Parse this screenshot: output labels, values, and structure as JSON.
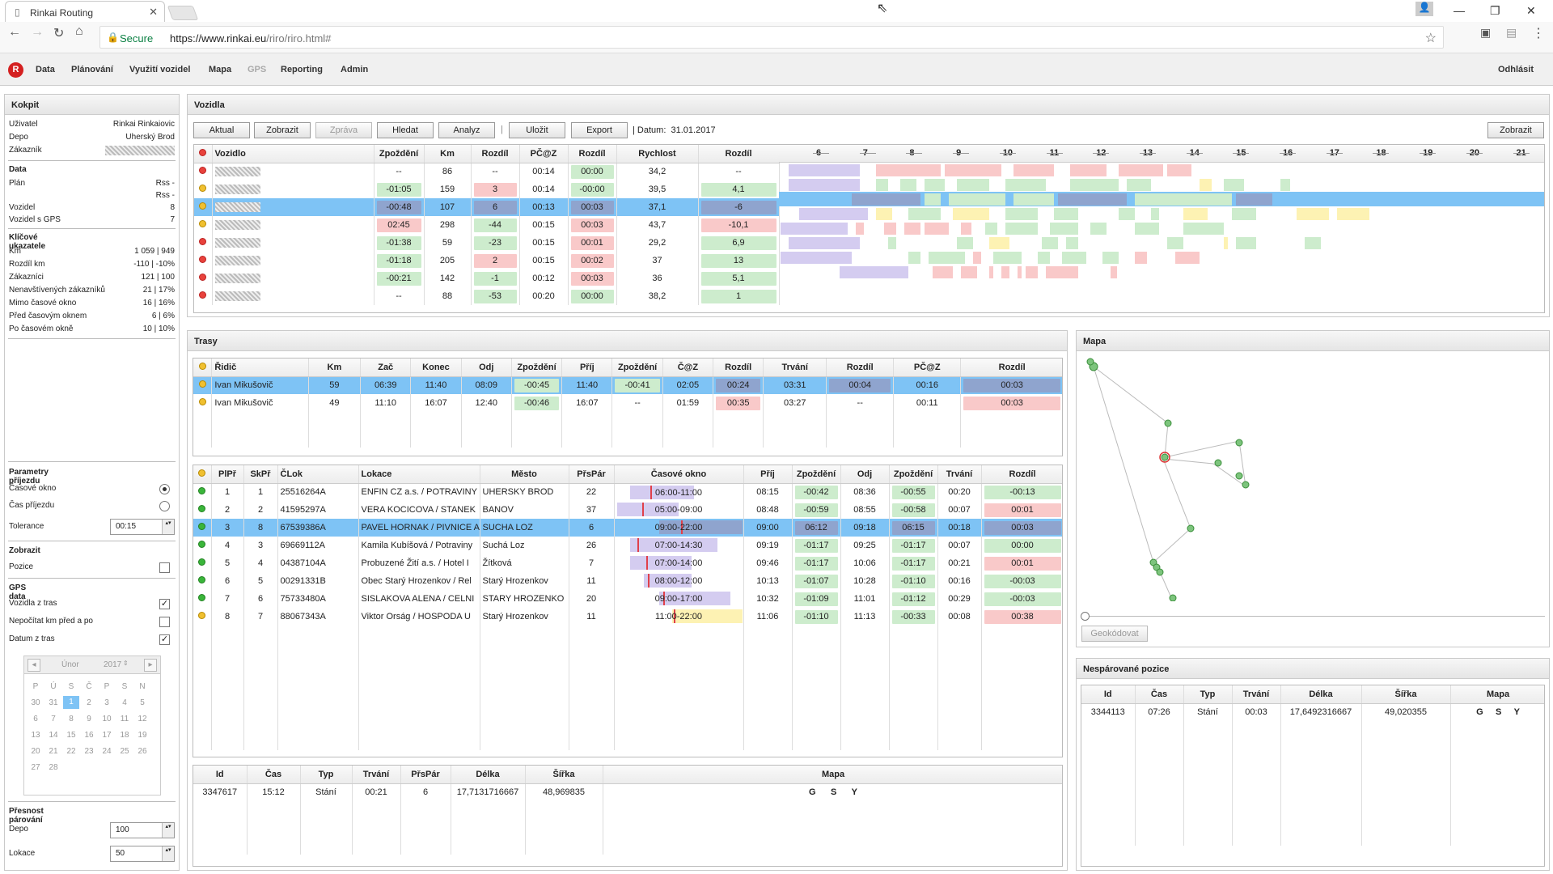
{
  "browser": {
    "tab_title": "Rinkai Routing",
    "secure_label": "Secure",
    "url_base": "https://www.rinkai.eu",
    "url_path": "/riro/riro.html#"
  },
  "menu": {
    "items": [
      "Data",
      "Plánování",
      "Využití vozidel",
      "Mapa",
      "GPS",
      "Reporting",
      "Admin"
    ],
    "logout": "Odhlásit"
  },
  "kokpit": {
    "title": "Kokpit",
    "user_rows": [
      {
        "k": "Uživatel",
        "v": "Rinkai Rinkaiovic"
      },
      {
        "k": "Depo",
        "v": "Uherský Brod"
      },
      {
        "k": "Zákazník",
        "v": ""
      }
    ],
    "data_title": "Data",
    "data_rows": [
      {
        "k": "Plán",
        "v": "Rss -"
      },
      {
        "k": "",
        "v": "Rss -"
      },
      {
        "k": "Vozidel",
        "v": "8"
      },
      {
        "k": "Vozidel s GPS",
        "v": "7"
      }
    ],
    "kpi_title": "Klíčové ukazatele",
    "kpi_rows": [
      {
        "k": "Km",
        "v": "1 059 | 949"
      },
      {
        "k": "Rozdíl km",
        "v": "-110 | -10%"
      },
      {
        "k": "Zákazníci",
        "v": "121 | 100"
      },
      {
        "k": "Nenavštívených zákazníků",
        "v": "21 | 17%"
      },
      {
        "k": "Mimo časové okno",
        "v": "16 | 16%"
      },
      {
        "k": "Před časovým oknem",
        "v": "6 | 6%"
      },
      {
        "k": "Po časovém okně",
        "v": "10 | 10%"
      }
    ],
    "params_title": "Parametry příjezdu",
    "param_time_window": "Časové okno",
    "param_arrival": "Čas příjezdu",
    "tolerance_label": "Tolerance",
    "tolerance_value": "00:15",
    "show_title": "Zobrazit",
    "show_pos": "Pozice",
    "gps_title": "GPS data",
    "gps_rows": [
      {
        "k": "Vozidla z tras",
        "checked": true
      },
      {
        "k": "Nepočítat km před a po",
        "checked": false
      },
      {
        "k": "Datum z tras",
        "checked": true
      }
    ],
    "cal_month": "Únor",
    "cal_year": "2017",
    "cal_days": [
      "P",
      "Ú",
      "S",
      "Č",
      "P",
      "S",
      "N"
    ],
    "cal_dates": [
      "30",
      "31",
      "1",
      "2",
      "3",
      "4",
      "5",
      "6",
      "7",
      "8",
      "9",
      "10",
      "11",
      "12",
      "13",
      "14",
      "15",
      "16",
      "17",
      "18",
      "19",
      "20",
      "21",
      "22",
      "23",
      "24",
      "25",
      "26",
      "27",
      "28"
    ],
    "pair_title": "Přesnost párování",
    "depo_label": "Depo",
    "depo_value": "100",
    "lok_label": "Lokace",
    "lok_value": "50"
  },
  "vozidla": {
    "title": "Vozidla",
    "buttons": [
      "Aktual",
      "Zobrazit",
      "Zpráva",
      "Hledat",
      "Analyz",
      "Uložit",
      "Export"
    ],
    "date_label": "Datum:",
    "date_value": "31.01.2017",
    "btn_right": "Zobrazit",
    "columns": [
      "Vozidlo",
      "Zpoždění",
      "Km",
      "Rozdíl",
      "PČ@Z",
      "Rozdíl",
      "Rychlost",
      "Rozdíl"
    ],
    "hours": [
      "6",
      "7",
      "8",
      "9",
      "10",
      "11",
      "12",
      "13",
      "14",
      "15",
      "16",
      "17",
      "18",
      "19",
      "20",
      "21"
    ],
    "rows": [
      {
        "status": "r",
        "zp": "--",
        "km": "86",
        "rz": "--",
        "pc": "00:14",
        "rz2": "00:00",
        "ry": "34,2",
        "rz3": "--"
      },
      {
        "status": "y",
        "zp": "-01:05",
        "km": "159",
        "rz": "3",
        "pc": "00:14",
        "rz2": "-00:00",
        "ry": "39,5",
        "rz3": "4,1"
      },
      {
        "status": "y",
        "zp": "-00:48",
        "km": "107",
        "rz": "6",
        "pc": "00:13",
        "rz2": "00:03",
        "ry": "37,1",
        "rz3": "-6",
        "sel": true
      },
      {
        "status": "y",
        "zp": "02:45",
        "km": "298",
        "rz": "-44",
        "pc": "00:15",
        "rz2": "00:03",
        "ry": "43,7",
        "rz3": "-10,1"
      },
      {
        "status": "r",
        "zp": "-01:38",
        "km": "59",
        "rz": "-23",
        "pc": "00:15",
        "rz2": "00:01",
        "ry": "29,2",
        "rz3": "6,9"
      },
      {
        "status": "r",
        "zp": "-01:18",
        "km": "205",
        "rz": "2",
        "pc": "00:15",
        "rz2": "00:02",
        "ry": "37",
        "rz3": "13"
      },
      {
        "status": "r",
        "zp": "-00:21",
        "km": "142",
        "rz": "-1",
        "pc": "00:12",
        "rz2": "00:03",
        "ry": "36",
        "rz3": "5,1"
      },
      {
        "status": "r",
        "zp": "--",
        "km": "88",
        "rz": "-53",
        "pc": "00:20",
        "rz2": "00:00",
        "ry": "38,2",
        "rz3": "1"
      }
    ]
  },
  "trasy": {
    "title": "Trasy",
    "columns": [
      "Řidič",
      "Km",
      "Zač",
      "Konec",
      "Odj",
      "Zpoždění",
      "Příj",
      "Zpoždění",
      "Č@Z",
      "Rozdíl",
      "Trvání",
      "Rozdíl",
      "PČ@Z",
      "Rozdíl"
    ],
    "rows": [
      {
        "drv": "Ivan Mikušovič",
        "km": "59",
        "zac": "06:39",
        "kon": "11:40",
        "odj": "08:09",
        "zp": "-00:45",
        "prij": "11:40",
        "zp2": "-00:41",
        "cz": "02:05",
        "rz": "00:24",
        "trv": "03:31",
        "rz2": "00:04",
        "pcz": "00:16",
        "rz3": "00:03",
        "sel": true
      },
      {
        "drv": "Ivan Mikušovič",
        "km": "49",
        "zac": "11:10",
        "kon": "16:07",
        "odj": "12:40",
        "zp": "-00:46",
        "prij": "16:07",
        "zp2": "--",
        "cz": "01:59",
        "rz": "00:35",
        "trv": "03:27",
        "rz2": "--",
        "pcz": "00:11",
        "rz3": "00:03"
      }
    ]
  },
  "stops": {
    "columns": [
      "PlPř",
      "SkPř",
      "ČLok",
      "Lokace",
      "Město",
      "PřsPár",
      "Časové okno",
      "Příj",
      "Zpoždění",
      "Odj",
      "Zpoždění",
      "Trvání",
      "Rozdíl"
    ],
    "rows": [
      {
        "s": "g",
        "pl": "1",
        "sk": "1",
        "cl": "25516264A",
        "lok": "ENFIN CZ a.s. / POTRAVINY",
        "mes": "UHERSKY BROD",
        "pp": "22",
        "ok": "06:00-11:00",
        "pr": "08:15",
        "zp": "-00:42",
        "odj": "08:36",
        "zp2": "-00:55",
        "trv": "00:20",
        "rz": "-00:13"
      },
      {
        "s": "g",
        "pl": "2",
        "sk": "2",
        "cl": "41595297A",
        "lok": "VERA KOCICOVA / STANEK",
        "mes": "BANOV",
        "pp": "37",
        "ok": "05:00-09:00",
        "pr": "08:48",
        "zp": "-00:59",
        "odj": "08:55",
        "zp2": "-00:58",
        "trv": "00:07",
        "rz": "00:01"
      },
      {
        "s": "g",
        "pl": "3",
        "sk": "8",
        "cl": "67539386A",
        "lok": "PAVEL HORNAK / PIVNICE A",
        "mes": "SUCHA LOZ",
        "pp": "6",
        "ok": "09:00-22:00",
        "pr": "09:00",
        "zp": "06:12",
        "odj": "09:18",
        "zp2": "06:15",
        "trv": "00:18",
        "rz": "00:03",
        "sel": true
      },
      {
        "s": "g",
        "pl": "4",
        "sk": "3",
        "cl": "69669112A",
        "lok": "Kamila Kubíšová / Potraviny",
        "mes": "Suchá Loz",
        "pp": "26",
        "ok": "07:00-14:30",
        "pr": "09:19",
        "zp": "-01:17",
        "odj": "09:25",
        "zp2": "-01:17",
        "trv": "00:07",
        "rz": "00:00"
      },
      {
        "s": "g",
        "pl": "5",
        "sk": "4",
        "cl": "04387104A",
        "lok": "Probuzené Žití a.s. / Hotel I",
        "mes": "Žítková",
        "pp": "7",
        "ok": "07:00-14:00",
        "pr": "09:46",
        "zp": "-01:17",
        "odj": "10:06",
        "zp2": "-01:17",
        "trv": "00:21",
        "rz": "00:01"
      },
      {
        "s": "g",
        "pl": "6",
        "sk": "5",
        "cl": "00291331B",
        "lok": "Obec Starý Hrozenkov / Rel",
        "mes": "Starý Hrozenkov",
        "pp": "11",
        "ok": "08:00-12:00",
        "pr": "10:13",
        "zp": "-01:07",
        "odj": "10:28",
        "zp2": "-01:10",
        "trv": "00:16",
        "rz": "-00:03"
      },
      {
        "s": "g",
        "pl": "7",
        "sk": "6",
        "cl": "75733480A",
        "lok": "SISLAKOVA ALENA / CELNI",
        "mes": "STARY HROZENKO",
        "pp": "20",
        "ok": "09:00-17:00",
        "pr": "10:32",
        "zp": "-01:09",
        "odj": "11:01",
        "zp2": "-01:12",
        "trv": "00:29",
        "rz": "-00:03"
      },
      {
        "s": "y",
        "pl": "8",
        "sk": "7",
        "cl": "88067343A",
        "lok": "Viktor Orság / HOSPODA U",
        "mes": "Starý Hrozenkov",
        "pp": "11",
        "ok": "11:00-22:00",
        "pr": "11:06",
        "zp": "-01:10",
        "odj": "11:13",
        "zp2": "-00:33",
        "trv": "00:08",
        "rz": "00:38"
      }
    ]
  },
  "gps_bottom": {
    "columns": [
      "Id",
      "Čas",
      "Typ",
      "Trvání",
      "PřsPár",
      "Délka",
      "Šířka",
      "Mapa"
    ],
    "row": {
      "id": "3347617",
      "cas": "15:12",
      "typ": "Stání",
      "trv": "00:21",
      "pp": "6",
      "del": "17,7131716667",
      "sir": "48,969835",
      "g": "G",
      "s": "S",
      "y": "Y"
    }
  },
  "mapa": {
    "title": "Mapa",
    "geocode": "Geokódovat"
  },
  "nesp": {
    "title": "Nespárované pozice",
    "columns": [
      "Id",
      "Čas",
      "Typ",
      "Trvání",
      "Délka",
      "Šířka",
      "Mapa"
    ],
    "row": {
      "id": "3344113",
      "cas": "07:26",
      "typ": "Stání",
      "trv": "00:03",
      "del": "17,6492316667",
      "sir": "49,020355",
      "g": "G",
      "s": "S",
      "y": "Y"
    }
  },
  "colors": {
    "selected": "#7ec3f5",
    "green": "#cdeccd",
    "red": "#f9c9c9",
    "gray_blue": "#8fa4ce",
    "yellow": "#fdf2b3",
    "purple": "#d4ccf0"
  }
}
